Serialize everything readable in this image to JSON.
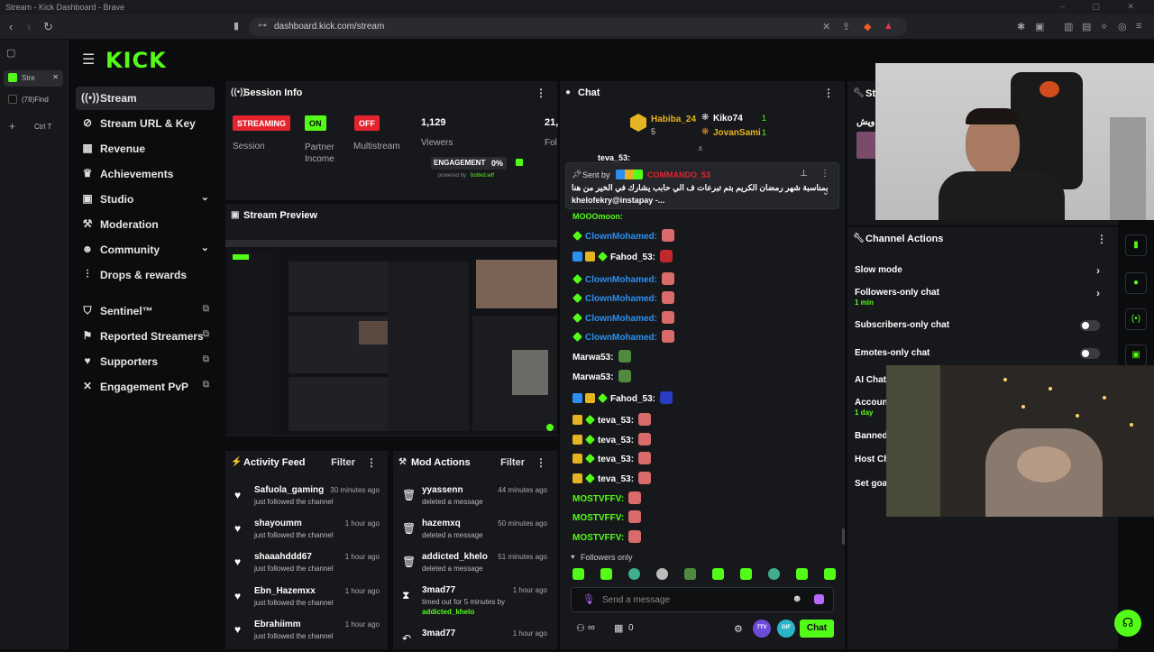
{
  "browser": {
    "title": "Stream - Kick Dashboard - Brave",
    "url": "dashboard.kick.com/stream",
    "tabs": [
      {
        "label": "Stre"
      },
      {
        "label": "(78)Find"
      }
    ],
    "ctrl_t": "Ctrl  T"
  },
  "app": {
    "logo": "KICK"
  },
  "sidebar": {
    "items": [
      {
        "label": "Stream",
        "icon": "broadcast-icon"
      },
      {
        "label": "Stream URL & Key",
        "icon": "link-icon"
      },
      {
        "label": "Revenue",
        "icon": "revenue-icon"
      },
      {
        "label": "Achievements",
        "icon": "trophy-icon"
      },
      {
        "label": "Studio",
        "icon": "studio-icon"
      },
      {
        "label": "Moderation",
        "icon": "hammer-icon"
      },
      {
        "label": "Community",
        "icon": "people-icon"
      },
      {
        "label": "Drops & rewards",
        "icon": "drops-icon"
      },
      {
        "label": "Sentinel™",
        "icon": "shield-icon"
      },
      {
        "label": "Reported Streamers",
        "icon": "flag-icon"
      },
      {
        "label": "Supporters",
        "icon": "heart-icon"
      },
      {
        "label": "Engagement PvP",
        "icon": "swords-icon"
      }
    ]
  },
  "session_info": {
    "title": "Session Info",
    "session_badge": "STREAMING",
    "session_label": "Session",
    "partner_badge": "ON",
    "partner_label": "Partner Income",
    "multistream_badge": "OFF",
    "multistream_label": "Multistream",
    "viewers_value": "1,129",
    "viewers_label": "Viewers",
    "followers_value": "21,",
    "followers_label": "Fol",
    "engagement_label": "ENGAGEMENT",
    "engagement_value": "0%",
    "powered_by": "powered by",
    "powered_brand": "botted.wtf"
  },
  "stream_preview": {
    "title": "Stream Preview"
  },
  "activity_feed": {
    "title": "Activity Feed",
    "filter": "Filter",
    "rows": [
      {
        "name": "Safuola_gaming",
        "time": "30 minutes ago",
        "desc": "just followed the channel"
      },
      {
        "name": "shayoumm",
        "time": "1 hour ago",
        "desc": "just followed the channel"
      },
      {
        "name": "shaaahddd67",
        "time": "1 hour ago",
        "desc": "just followed the channel"
      },
      {
        "name": "Ebn_Hazemxx",
        "time": "1 hour ago",
        "desc": "just followed the channel"
      },
      {
        "name": "Ebrahiimm",
        "time": "1 hour ago",
        "desc": "just followed the channel"
      }
    ]
  },
  "mod_actions": {
    "title": "Mod Actions",
    "filter": "Filter",
    "rows": [
      {
        "name": "yyassenn",
        "time": "44 minutes ago",
        "desc": "deleted a message",
        "extra": ""
      },
      {
        "name": "hazemxq",
        "time": "50 minutes ago",
        "desc": "deleted a message",
        "extra": ""
      },
      {
        "name": "addicted_khelo",
        "time": "51 minutes ago",
        "desc": "deleted a message",
        "extra": ""
      },
      {
        "name": "3mad77",
        "time": "1 hour ago",
        "desc": "timed out for 5 minutes by",
        "extra": "addicted_khelo"
      },
      {
        "name": "3mad77",
        "time": "1 hour ago",
        "desc": "",
        "extra": ""
      }
    ]
  },
  "chat": {
    "title": "Chat",
    "top_gifters": [
      {
        "name": "Habiba_24",
        "count": "5"
      },
      {
        "name": "Kiko74",
        "count": "1"
      },
      {
        "name": "JovanSami",
        "count": "1"
      }
    ],
    "pinned": {
      "sent_by": "Sent by",
      "author": "COMMANDO_53",
      "text_line1": "بمناسبة شهر رمضان الكريم بتم تبرعات ف الي حابب يشارك في الخير من هنا",
      "text_line2": "khelofekry@instapay -..."
    },
    "hidden_top": "teva_53:",
    "hidden_top2": "MOOOmoon:",
    "messages": [
      {
        "user": "ClownMohamed:",
        "color": "#2b8ff0"
      },
      {
        "user": "Fahod_53:",
        "color": "#ffffff"
      },
      {
        "user": "ClownMohamed:",
        "color": "#2b8ff0"
      },
      {
        "user": "ClownMohamed:",
        "color": "#2b8ff0"
      },
      {
        "user": "ClownMohamed:",
        "color": "#2b8ff0"
      },
      {
        "user": "ClownMohamed:",
        "color": "#2b8ff0"
      },
      {
        "user": "Marwa53:",
        "color": "#ffffff"
      },
      {
        "user": "Marwa53:",
        "color": "#ffffff"
      },
      {
        "user": "Fahod_53:",
        "color": "#ffffff"
      },
      {
        "user": "teva_53:",
        "color": "#ffffff"
      },
      {
        "user": "teva_53:",
        "color": "#ffffff"
      },
      {
        "user": "teva_53:",
        "color": "#ffffff"
      },
      {
        "user": "teva_53:",
        "color": "#ffffff"
      },
      {
        "user": "MOSTVFFV:",
        "color": "#53fc18"
      },
      {
        "user": "MOSTVFFV:",
        "color": "#53fc18"
      },
      {
        "user": "MOSTVFFV:",
        "color": "#53fc18"
      }
    ],
    "followers_only": "Followers only",
    "placeholder": "Send a message",
    "infinity": "∞",
    "zero": "0",
    "badge_7tv": "7TV",
    "badge_gif": "GIF",
    "send": "Chat"
  },
  "channel_actions": {
    "title": "Channel Actions",
    "rows": [
      {
        "label": "Slow mode",
        "sub": ""
      },
      {
        "label": "Followers-only chat",
        "sub": "1 min"
      },
      {
        "label": "Subscribers-only chat",
        "sub": ""
      },
      {
        "label": "Emotes-only chat",
        "sub": ""
      },
      {
        "label": "AI Chat",
        "sub": ""
      },
      {
        "label": "Accoun",
        "sub": "1 day"
      },
      {
        "label": "Banned",
        "sub": ""
      },
      {
        "label": "Host Ch",
        "sub": ""
      },
      {
        "label": "Set goa",
        "sub": ""
      }
    ],
    "stub_title": "St",
    "stub_user": "اوپش"
  },
  "colors": {
    "accent": "#53fc18",
    "streaming": "#e5232f",
    "off": "#e5232f",
    "on": "#53fc18",
    "panel": "#17181b"
  }
}
